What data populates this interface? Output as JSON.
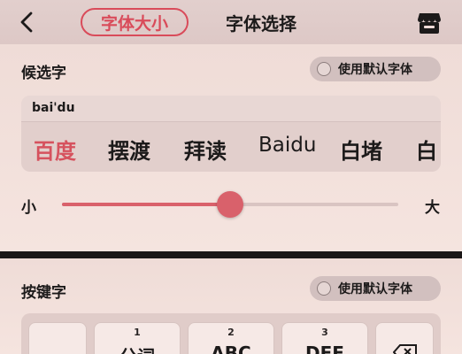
{
  "header": {
    "tab_font_size": "字体大小",
    "title": "字体选择",
    "back_icon": "back-chevron-icon",
    "store_icon": "store-icon"
  },
  "candidates_section": {
    "title": "候选字",
    "default_toggle_label": "使用默认字体",
    "pinyin": "bai'du",
    "items": [
      "百度",
      "摆渡",
      "拜读",
      "Baidu",
      "白堵",
      "白"
    ]
  },
  "font_size_slider": {
    "min_label": "小",
    "max_label": "大",
    "value_fraction": 0.5
  },
  "keys_section": {
    "title": "按键字",
    "default_toggle_label": "使用默认字体",
    "keys": [
      {
        "num": "",
        "label": ""
      },
      {
        "num": "1",
        "label": "分词"
      },
      {
        "num": "2",
        "label": "ABC"
      },
      {
        "num": "3",
        "label": "DEF"
      }
    ],
    "delete_icon": "backspace-icon"
  },
  "colors": {
    "accent": "#d94b5a",
    "slider": "#d9616b",
    "divider": "#1b1717"
  }
}
